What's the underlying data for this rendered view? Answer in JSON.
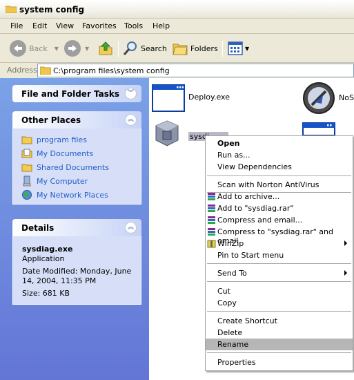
{
  "window": {
    "title": "system config"
  },
  "menu": [
    "File",
    "Edit",
    "View",
    "Favorites",
    "Tools",
    "Help"
  ],
  "toolbar": {
    "back": "Back",
    "search": "Search",
    "folders": "Folders"
  },
  "address": {
    "label": "Address",
    "path": "C:\\program files\\system config"
  },
  "tasks_panel": {
    "title": "File and Folder Tasks"
  },
  "other_places": {
    "title": "Other Places",
    "items": [
      "program files",
      "My Documents",
      "Shared Documents",
      "My Computer",
      "My Network Places"
    ]
  },
  "details": {
    "title": "Details",
    "name": "sysdiag.exe",
    "type": "Application",
    "modified": "Date Modified: Monday, June 14, 2004, 11:35 PM",
    "size": "Size: 681 KB"
  },
  "files": [
    {
      "name": "Deploy.exe"
    },
    {
      "name": "NoSt"
    },
    {
      "name": "sysdi"
    }
  ],
  "context_menu": {
    "items": [
      "Open",
      "Run as...",
      "View Dependencies",
      "Scan with Norton AntiVirus",
      "Add to archive...",
      "Add to \"sysdiag.rar\"",
      "Compress and email...",
      "Compress to \"sysdiag.rar\" and email",
      "WinZip",
      "Pin to Start menu",
      "Send To",
      "Cut",
      "Copy",
      "Create Shortcut",
      "Delete",
      "Rename",
      "Properties"
    ],
    "selected": "Rename"
  }
}
